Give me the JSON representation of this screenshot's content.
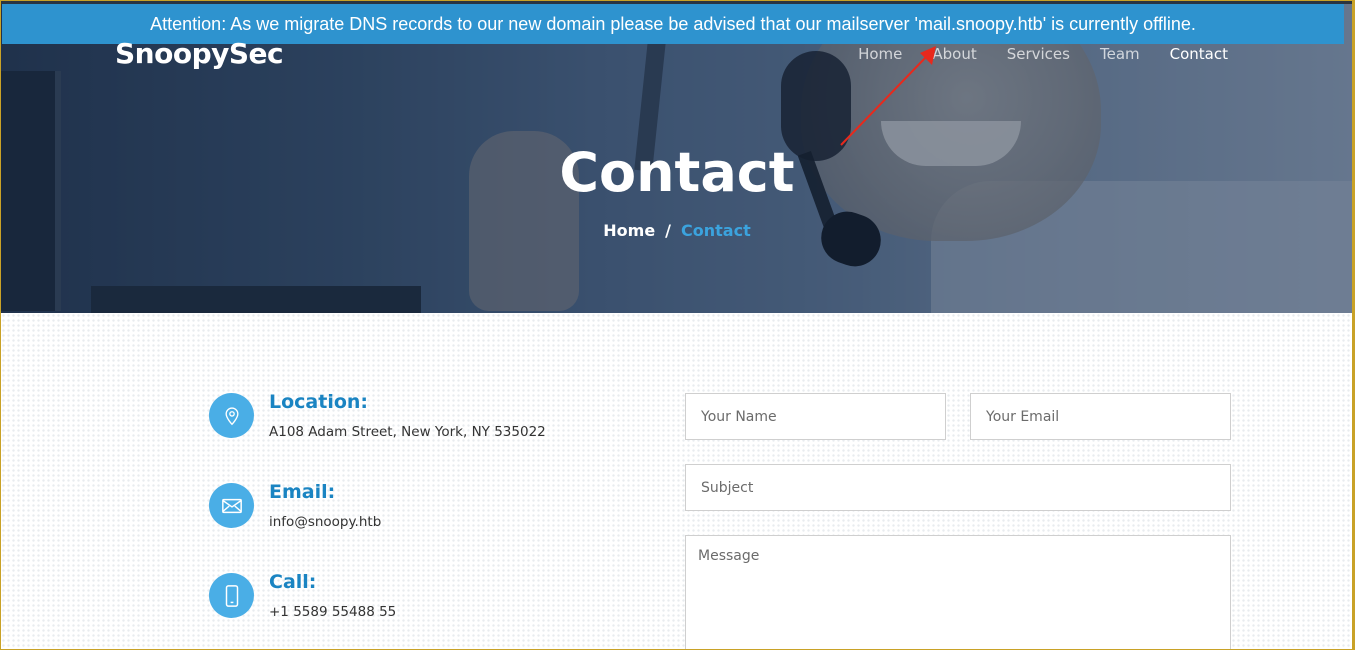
{
  "banner": {
    "text": "Attention: As we migrate DNS records to our new domain please be advised that our mailserver 'mail.snoopy.htb' is currently offline."
  },
  "brand": {
    "name": "SnoopySec"
  },
  "nav": {
    "items": [
      {
        "label": "Home"
      },
      {
        "label": "About"
      },
      {
        "label": "Services"
      },
      {
        "label": "Team"
      },
      {
        "label": "Contact"
      }
    ],
    "active": "Contact"
  },
  "hero": {
    "title": "Contact",
    "breadcrumb": {
      "home": "Home",
      "separator": "/",
      "current": "Contact"
    }
  },
  "contact": {
    "location": {
      "title": "Location:",
      "value": "A108 Adam Street, New York, NY 535022",
      "icon": "map-pin-icon"
    },
    "email": {
      "title": "Email:",
      "value": "info@snoopy.htb",
      "icon": "envelope-icon"
    },
    "call": {
      "title": "Call:",
      "value": "+1 5589 55488 55",
      "icon": "phone-icon"
    }
  },
  "form": {
    "name_placeholder": "Your Name",
    "email_placeholder": "Your Email",
    "subject_placeholder": "Subject",
    "message_placeholder": "Message"
  },
  "colors": {
    "banner_bg": "#2e93cf",
    "accent": "#1a84c2",
    "icon_bg": "#4aaee6",
    "annotation_arrow": "#e8291c"
  }
}
